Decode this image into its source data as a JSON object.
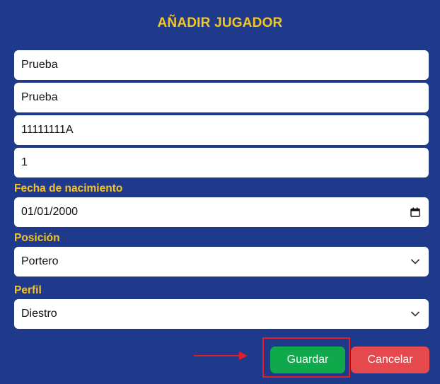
{
  "form": {
    "title": "AÑADIR JUGADOR",
    "fields": {
      "name": "Prueba",
      "surname": "Prueba",
      "dni": "11111111A",
      "number": "1"
    },
    "birthdate": {
      "label": "Fecha de nacimiento",
      "value": "01/01/2000"
    },
    "position": {
      "label": "Posición",
      "value": "Portero"
    },
    "profile": {
      "label": "Perfil",
      "value": "Diestro"
    },
    "buttons": {
      "save": "Guardar",
      "cancel": "Cancelar"
    }
  },
  "colors": {
    "background": "#1f3a8a",
    "accent": "#f5c524",
    "save": "#0fa84a",
    "cancel": "#e5484d",
    "annotation": "#e31e24"
  },
  "icons": {
    "birthdate": "calendar-icon",
    "position": "chevron-down-icon",
    "profile": "chevron-down-icon",
    "annotation": "arrow-right-icon"
  }
}
